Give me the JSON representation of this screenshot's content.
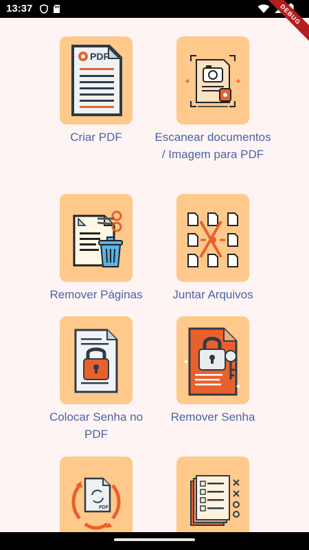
{
  "status_bar": {
    "time": "13:37",
    "left_icons": [
      "shield-icon",
      "sd-card-icon"
    ],
    "right_icons": [
      "wifi-icon",
      "signal-icon",
      "battery-icon"
    ]
  },
  "debug_banner": {
    "label": "DEBUG"
  },
  "colors": {
    "background": "#fdf4f3",
    "tile_bg": "#fec98b",
    "label": "#4a64a8",
    "accent": "#e8612c"
  },
  "tiles": [
    {
      "label": "Criar PDF",
      "icon": "create-pdf-icon",
      "icon_text": "PDF"
    },
    {
      "label": "Escanear documentos / Imagem para PDF",
      "icon": "scan-document-icon"
    },
    {
      "label": "Remover Páginas",
      "icon": "remove-pages-icon"
    },
    {
      "label": "Juntar Arquivos",
      "icon": "merge-files-icon"
    },
    {
      "label": "Colocar Senha no PDF",
      "icon": "lock-pdf-icon"
    },
    {
      "label": "Remover Senha",
      "icon": "remove-password-icon"
    },
    {
      "label": "",
      "icon": "rotate-pdf-icon",
      "icon_text": "PDF"
    },
    {
      "label": "",
      "icon": "checklist-document-icon"
    }
  ]
}
